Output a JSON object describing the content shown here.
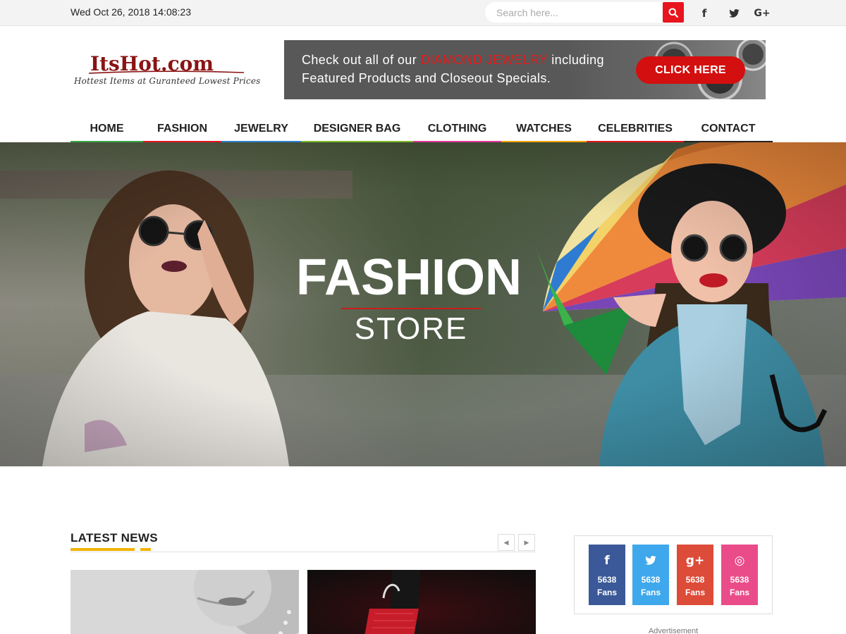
{
  "topbar": {
    "datetime": "Wed Oct 26, 2018 14:08:23",
    "search": {
      "placeholder": "Search here...",
      "value": "",
      "button_icon": "search-icon"
    },
    "social": [
      {
        "name": "facebook",
        "glyph": "f"
      },
      {
        "name": "twitter",
        "glyph": "🐦"
      },
      {
        "name": "google-plus",
        "glyph": "G+"
      }
    ]
  },
  "logo": {
    "name": "ItsHot",
    "suffix": ".com",
    "tagline": "Hottest Items at Guranteed Lowest Prices"
  },
  "ad_banner": {
    "text_before": "Check out all of our ",
    "highlight": "DIAMOND JEWELRY",
    "text_after": " including Featured Products and Closeout Specials.",
    "cta": "CLICK HERE",
    "highlight_color": "#e31a1a",
    "cta_color": "#d30f0f"
  },
  "nav": {
    "items": [
      {
        "label": "HOME",
        "color": "#3aa845"
      },
      {
        "label": "FASHION",
        "color": "#e8141e"
      },
      {
        "label": "JEWELRY",
        "color": "#2f82cc"
      },
      {
        "label": "DESIGNER BAG",
        "color": "#7fba2d"
      },
      {
        "label": "CLOTHING",
        "color": "#e0359a"
      },
      {
        "label": "WATCHES",
        "color": "#f0a500"
      },
      {
        "label": "CELEBRITIES",
        "color": "#e8141e"
      },
      {
        "label": "CONTACT",
        "color": "#222222"
      }
    ]
  },
  "hero": {
    "title": "FASHION",
    "subtitle": "STORE",
    "accent_color": "#cc1b1b"
  },
  "latest_news": {
    "title": "LATEST NEWS",
    "prev_icon": "chevron-left-icon",
    "next_icon": "chevron-right-icon",
    "accent_color": "#f0b400"
  },
  "social_counters": [
    {
      "network": "facebook",
      "glyph": "f",
      "count": "5638",
      "label": "Fans",
      "color": "#3b5998"
    },
    {
      "network": "twitter",
      "glyph": "🐦",
      "count": "5638",
      "label": "Fans",
      "color": "#3fa8ec"
    },
    {
      "network": "google-plus",
      "glyph": "g+",
      "count": "5638",
      "label": "Fans",
      "color": "#dd4b39"
    },
    {
      "network": "dribbble",
      "glyph": "◎",
      "count": "5638",
      "label": "Fans",
      "color": "#ea4c89"
    }
  ],
  "sidebar": {
    "advertisement_label": "Advertisement"
  }
}
